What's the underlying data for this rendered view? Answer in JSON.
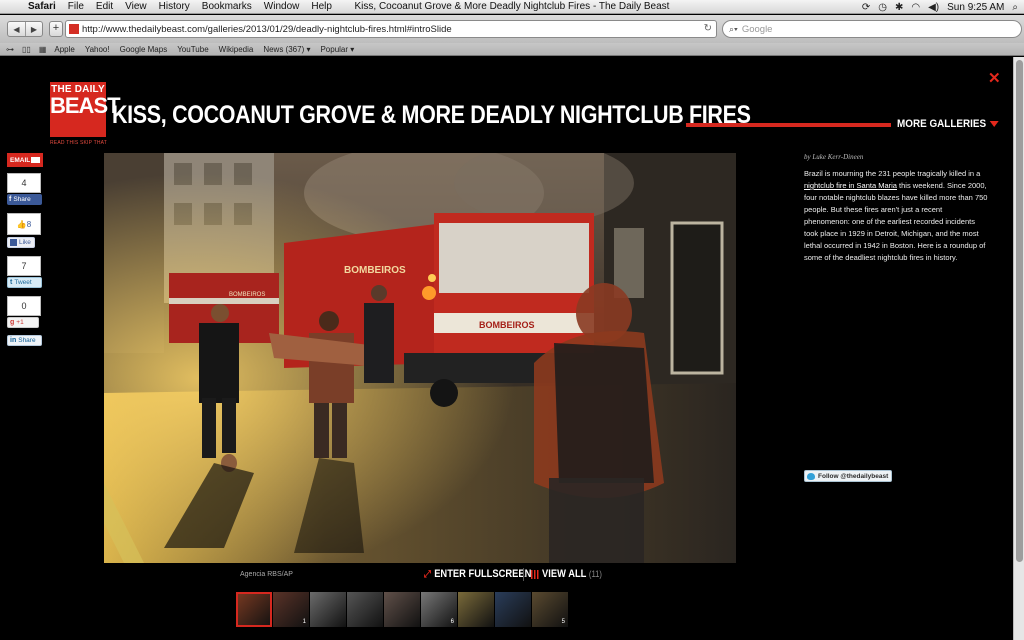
{
  "menubar": {
    "app": "Safari",
    "menus": [
      "File",
      "Edit",
      "View",
      "History",
      "Bookmarks",
      "Window",
      "Help"
    ],
    "window_title": "Kiss, Cocoanut Grove & More Deadly Nightclub Fires - The Daily Beast",
    "clock": "Sun 9:25 AM"
  },
  "toolbar": {
    "url": "http://www.thedailybeast.com/galleries/2013/01/29/deadly-nightclub-fires.html#introSlide",
    "search_placeholder": "Google"
  },
  "bookmarks": [
    "Apple",
    "Yahoo!",
    "Google Maps",
    "YouTube",
    "Wikipedia",
    "News (367) ▾",
    "Popular ▾"
  ],
  "logo": {
    "line1": "THE DAILY",
    "line2": "BEAST",
    "tagline": "READ THIS SKIP THAT"
  },
  "headline": "KISS, COCOANUT GROVE & MORE DEADLY NIGHTCLUB FIRES",
  "more_galleries": "MORE GALLERIES",
  "social": {
    "email": "EMAIL",
    "facebook_count": "4",
    "facebook_label": "Share",
    "like_count": "8",
    "like_label": "Like",
    "tweet_count": "7",
    "tweet_label": "Tweet",
    "gplus_count": "0",
    "gplus_label": "+1",
    "linkedin_label": "Share"
  },
  "photo": {
    "credit": "Agencia RBS/AP",
    "truck_text": "BOMBEIROS"
  },
  "controls": {
    "fullscreen": "ENTER FULLSCREEN",
    "view_all": "VIEW ALL",
    "view_all_count": "(11)"
  },
  "thumbnails": [
    {
      "num": "",
      "color": "#7a3a22"
    },
    {
      "num": "1",
      "color": "#5a3328"
    },
    {
      "num": "",
      "color": "#6b6b6b"
    },
    {
      "num": "",
      "color": "#555"
    },
    {
      "num": "",
      "color": "#605049"
    },
    {
      "num": "6",
      "color": "#777"
    },
    {
      "num": "",
      "color": "#7a6a3a"
    },
    {
      "num": "",
      "color": "#2a3d5a"
    },
    {
      "num": "5",
      "color": "#5a4a30"
    }
  ],
  "article": {
    "byline": "by Luke Kerr-Dineen",
    "text_before": "Brazil is mourning the 231 people tragically killed in a ",
    "link": "nightclub fire in Santa Maria",
    "text_after": " this weekend. Since 2000, four notable nightclub blazes have killed more than 750 people. But these fires aren't just a recent phenomenon: one of the earliest recorded incidents took place in 1929 in Detroit, Michigan, and the most lethal occurred in 1942 in Boston. Here is a roundup of some of the deadliest nightclub fires in history.",
    "follow": "Follow @thedailybeast"
  },
  "colors": {
    "brand_red": "#d6281f",
    "background": "#000000"
  }
}
